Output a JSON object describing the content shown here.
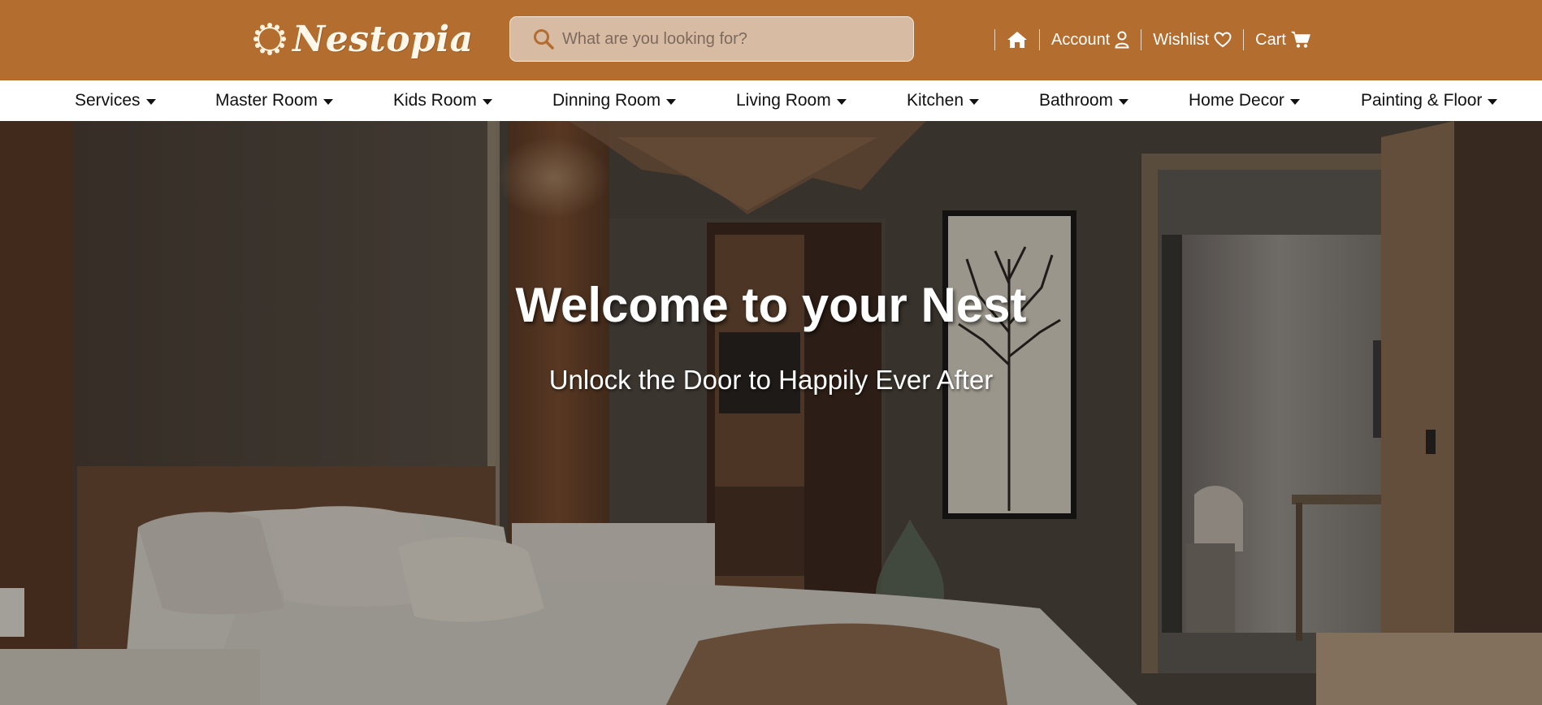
{
  "brand": {
    "name": "Nestopia",
    "logo_icon": "wreath-icon"
  },
  "search": {
    "placeholder": "What are you looking for?",
    "value": "",
    "icon": "search-icon"
  },
  "header_links": {
    "home_icon": "home-icon",
    "account_label": "Account",
    "wishlist_label": "Wishlist",
    "cart_label": "Cart"
  },
  "nav": {
    "items": [
      {
        "label": "Services"
      },
      {
        "label": "Master Room"
      },
      {
        "label": "Kids Room"
      },
      {
        "label": "Dinning Room"
      },
      {
        "label": "Living Room"
      },
      {
        "label": "Kitchen"
      },
      {
        "label": "Bathroom"
      },
      {
        "label": "Home Decor"
      },
      {
        "label": "Painting & Floor"
      }
    ]
  },
  "hero": {
    "title": "Welcome to your Nest",
    "subtitle": "Unlock the Door to Happily Ever After"
  },
  "colors": {
    "header_bg": "#b26d2f",
    "nav_bg": "#ffffff",
    "search_bg": "#d8bba3",
    "search_icon": "#b26d2f"
  }
}
